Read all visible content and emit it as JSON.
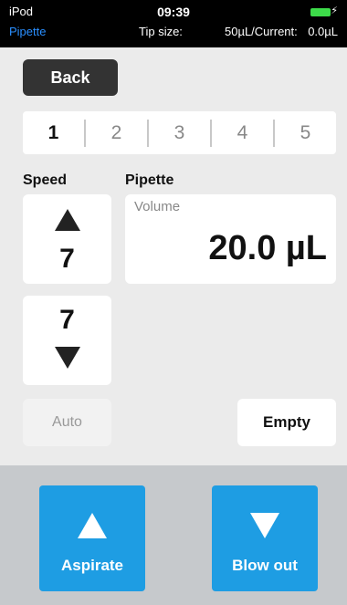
{
  "status_bar": {
    "device": "iPod",
    "time": "09:39",
    "app_name": "Pipette",
    "tip_size_label": "Tip size:",
    "tip_size_value": "50µL/Current:",
    "current_value": "0.0µL",
    "battery_color": "#3ddc4a",
    "charging_icon": "⚡"
  },
  "toolbar": {
    "back_label": "Back"
  },
  "segments": {
    "selected_index": 0,
    "items": [
      "1",
      "2",
      "3",
      "4",
      "5"
    ]
  },
  "speed": {
    "label": "Speed",
    "up_value": "7",
    "down_value": "7"
  },
  "pipette": {
    "label": "Pipette",
    "volume_caption": "Volume",
    "volume_value": "20.0 µL"
  },
  "buttons": {
    "auto_label": "Auto",
    "empty_label": "Empty",
    "aspirate_label": "Aspirate",
    "blowout_label": "Blow out"
  },
  "colors": {
    "action_blue": "#1e9de3",
    "status_blue": "#2a8fff",
    "bottom_bar": "#c6c9cc"
  }
}
